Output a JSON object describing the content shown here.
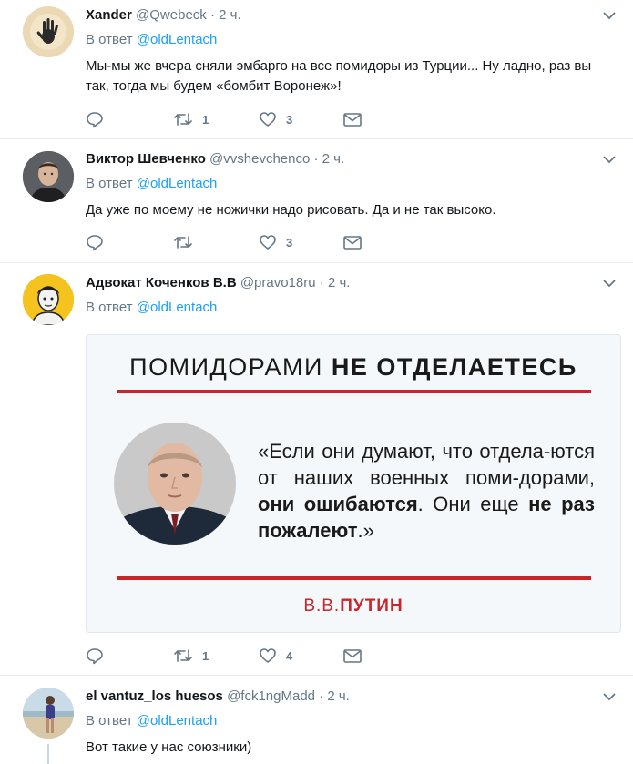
{
  "reply_prefix": "В ответ",
  "tweets": [
    {
      "name": "Xander",
      "handle": "@Qwebeck",
      "dot": "·",
      "time": "2 ч.",
      "reply_to": "@oldLentach",
      "text": "Мы-мы же вчера сняли эмбарго на все помидоры из Турции... Ну ладно, раз вы так, тогда мы будем «бомбит Воронеж»!",
      "retweets": "1",
      "likes": "3"
    },
    {
      "name": "Виктор Шевченко",
      "handle": "@vvshevchenco",
      "dot": "·",
      "time": "2 ч.",
      "reply_to": "@oldLentach",
      "text": "Да уже по моему не ножички надо рисовать. Да и не так высоко.",
      "retweets": "",
      "likes": "3"
    },
    {
      "name": "Адвокат Коченков В.В",
      "handle": "@pravo18ru",
      "dot": "·",
      "time": "2 ч.",
      "reply_to": "@oldLentach",
      "retweets": "1",
      "likes": "4",
      "card": {
        "title_light": "ПОМИДОРАМИ ",
        "title_bold": "НЕ ОТДЕЛАЕТЕСЬ",
        "quote_1": "«Если они думают, что отдела-ются от наших военных поми-дорами, ",
        "quote_bold_1": "они ошибаются",
        "quote_2": ". Они еще ",
        "quote_bold_2": "не раз пожалеют",
        "quote_3": ".»",
        "sign_light": "В.В.",
        "sign_bold": "ПУТИН"
      }
    },
    {
      "name": "el vantuz_los huesos",
      "handle": "@fck1ngMadd",
      "dot": "·",
      "time": "2 ч.",
      "reply_to": "@oldLentach",
      "text": "Вот такие у нас союзники)"
    }
  ],
  "colors": {
    "accent": "#1da1f2",
    "secondary_text": "#657786",
    "divider": "#e6ecf0",
    "card_red": "#c8262b"
  }
}
